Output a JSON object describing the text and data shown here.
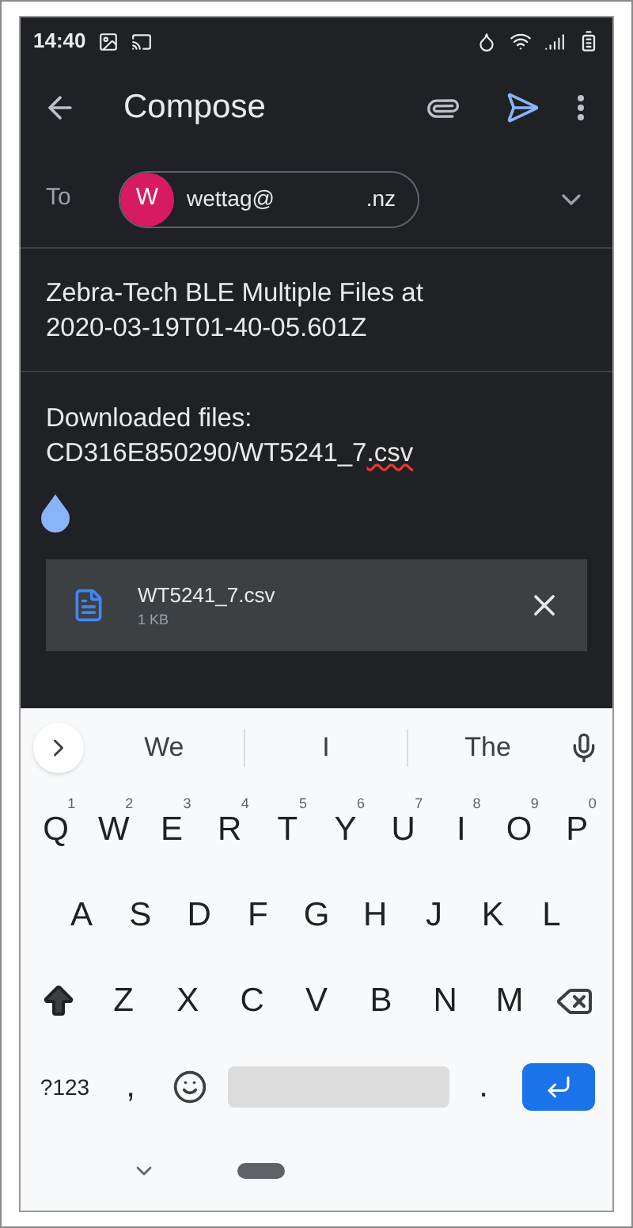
{
  "status_bar": {
    "time": "14:40"
  },
  "app_bar": {
    "title": "Compose"
  },
  "to": {
    "label": "To",
    "recipient": {
      "initial": "W",
      "address_start": "wettag@",
      "address_end": ".nz"
    }
  },
  "subject": "Zebra-Tech BLE Multiple Files at 2020-03-19T01-40-05.601Z",
  "body": {
    "lines": [
      [
        {
          "text": "Downloaded files:",
          "misspelled": false
        }
      ],
      [
        {
          "text": "CD316E850290/WT5241_7",
          "misspelled": false
        },
        {
          "text": ".csv",
          "misspelled": true
        }
      ]
    ]
  },
  "attachment": {
    "name": "WT5241_7.csv",
    "size": "1 KB"
  },
  "keyboard": {
    "suggestions": [
      "We",
      "I",
      "The"
    ],
    "rows": [
      [
        {
          "kind": "letter",
          "label": "Q",
          "hint": "1"
        },
        {
          "kind": "letter",
          "label": "W",
          "hint": "2"
        },
        {
          "kind": "letter",
          "label": "E",
          "hint": "3"
        },
        {
          "kind": "letter",
          "label": "R",
          "hint": "4"
        },
        {
          "kind": "letter",
          "label": "T",
          "hint": "5"
        },
        {
          "kind": "letter",
          "label": "Y",
          "hint": "6"
        },
        {
          "kind": "letter",
          "label": "U",
          "hint": "7"
        },
        {
          "kind": "letter",
          "label": "I",
          "hint": "8"
        },
        {
          "kind": "letter",
          "label": "O",
          "hint": "9"
        },
        {
          "kind": "letter",
          "label": "P",
          "hint": "0"
        }
      ],
      [
        {
          "kind": "letter",
          "label": "A"
        },
        {
          "kind": "letter",
          "label": "S"
        },
        {
          "kind": "letter",
          "label": "D"
        },
        {
          "kind": "letter",
          "label": "F"
        },
        {
          "kind": "letter",
          "label": "G"
        },
        {
          "kind": "letter",
          "label": "H"
        },
        {
          "kind": "letter",
          "label": "J"
        },
        {
          "kind": "letter",
          "label": "K"
        },
        {
          "kind": "letter",
          "label": "L"
        }
      ],
      [
        {
          "kind": "shift"
        },
        {
          "kind": "letter",
          "label": "Z"
        },
        {
          "kind": "letter",
          "label": "X"
        },
        {
          "kind": "letter",
          "label": "C"
        },
        {
          "kind": "letter",
          "label": "V"
        },
        {
          "kind": "letter",
          "label": "B"
        },
        {
          "kind": "letter",
          "label": "N"
        },
        {
          "kind": "letter",
          "label": "M"
        },
        {
          "kind": "backspace"
        }
      ],
      [
        {
          "kind": "symbols",
          "label": "?123"
        },
        {
          "kind": "letter",
          "label": ","
        },
        {
          "kind": "emoji"
        },
        {
          "kind": "space"
        },
        {
          "kind": "letter",
          "label": "."
        },
        {
          "kind": "enter"
        }
      ]
    ]
  }
}
